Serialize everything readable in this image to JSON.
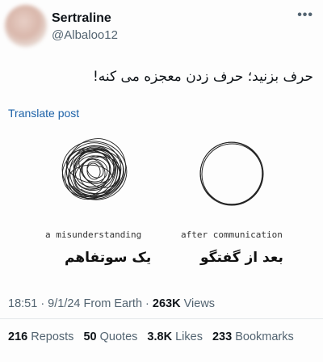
{
  "author": {
    "name": "Sertraline",
    "handle": "@Albaloo12"
  },
  "post": {
    "text": "حرف بزنید؛ حرف زدن معجزه می کنه!",
    "translate_label": "Translate post"
  },
  "image": {
    "left_caption": "a misunderstanding",
    "left_caption_fa": "یک سوتفاهم",
    "right_caption": "after communication",
    "right_caption_fa": "بعد از گفتگو"
  },
  "meta": {
    "time_date": "18:51 · 9/1/24 From Earth · ",
    "views_count": "263K",
    "views_label": " Views"
  },
  "stats": {
    "reposts_count": "216",
    "reposts_label": " Reposts",
    "quotes_count": "50",
    "quotes_label": " Quotes",
    "likes_count": "3.8K",
    "likes_label": " Likes",
    "bookmarks_count": "233",
    "bookmarks_label": " Bookmarks"
  },
  "icons": {
    "more": "more-dots-icon"
  }
}
